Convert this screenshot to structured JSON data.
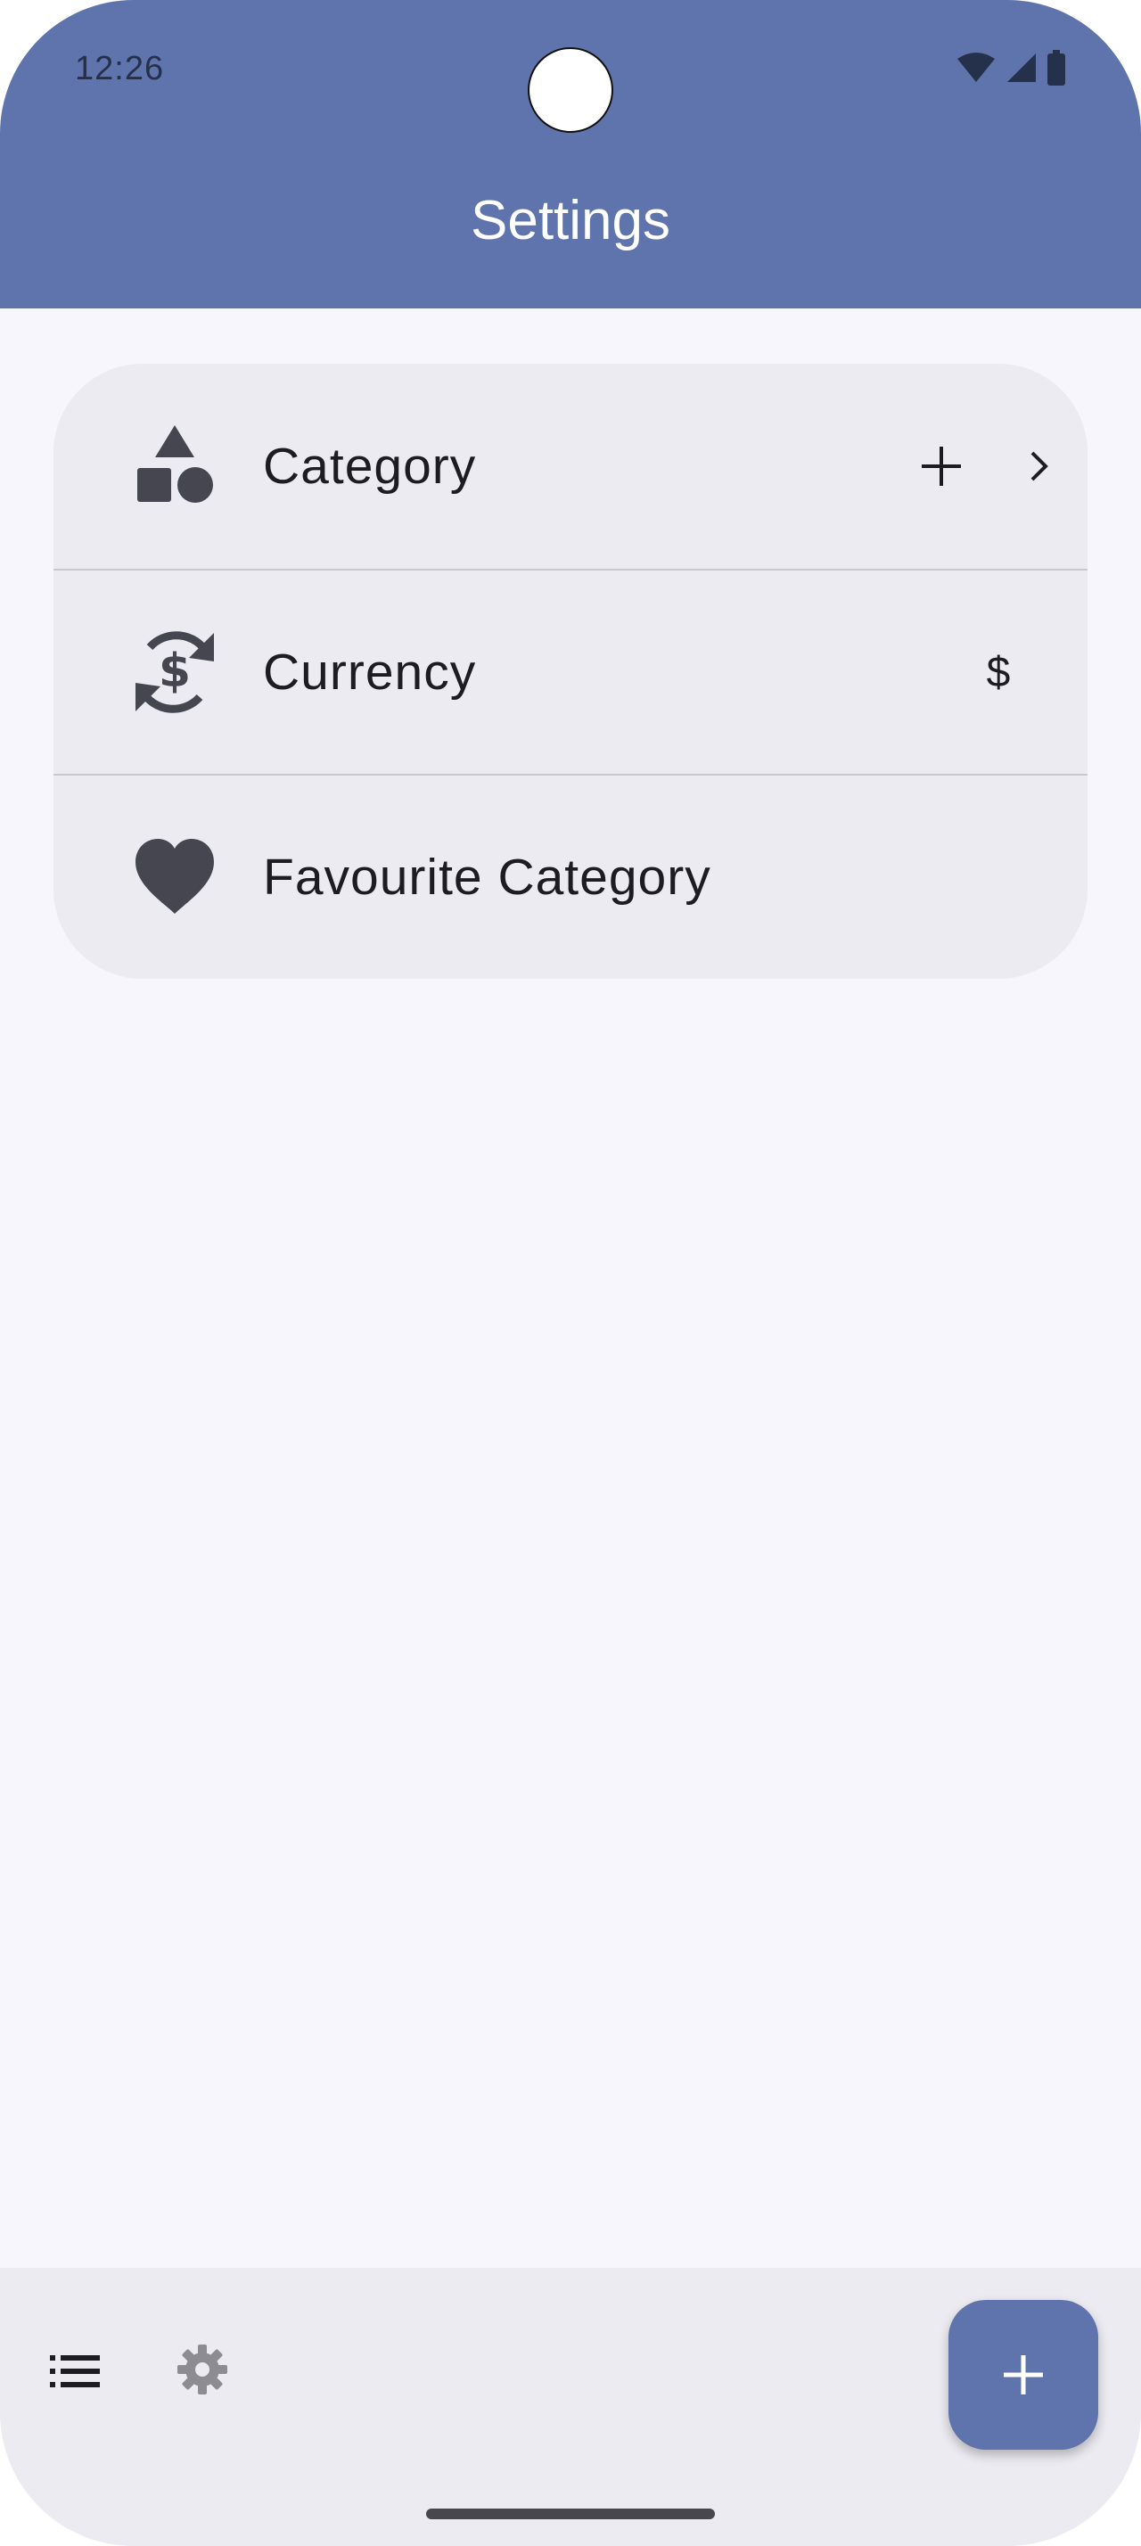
{
  "status_bar": {
    "time": "12:26"
  },
  "app_bar": {
    "title": "Settings"
  },
  "settings": {
    "items": [
      {
        "label": "Category",
        "icon": "category-shapes-icon",
        "trailing": [
          "add-icon",
          "chevron-right-icon"
        ]
      },
      {
        "label": "Currency",
        "icon": "currency-exchange-icon",
        "value": "$"
      },
      {
        "label": "Favourite Category",
        "icon": "heart-icon"
      }
    ]
  },
  "bottom_nav": {
    "items": [
      {
        "icon": "list-icon",
        "selected": true
      },
      {
        "icon": "gear-icon",
        "selected": false
      }
    ],
    "fab_icon": "add-icon"
  },
  "colors": {
    "primary": "#5f74ac",
    "background": "#f7f6fc",
    "surface": "#ecebf1",
    "on_surface": "#1d1c22",
    "icon": "#45464f"
  }
}
